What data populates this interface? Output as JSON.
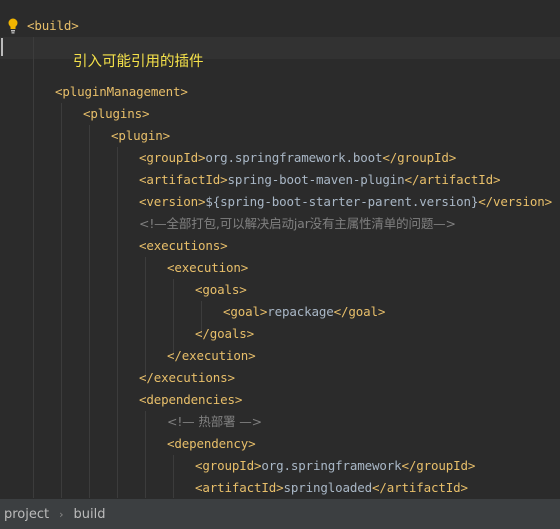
{
  "editor": {
    "annotation": "引入可能引用的插件",
    "lines": [
      {
        "tag": "build",
        "kind": "open"
      },
      {
        "tag": "pluginManagement",
        "kind": "open"
      },
      {
        "tag": "plugins",
        "kind": "open"
      },
      {
        "tag": "plugin",
        "kind": "open"
      },
      {
        "tag": "groupId",
        "value": "org.springframework.boot"
      },
      {
        "tag": "artifactId",
        "value": "spring-boot-maven-plugin"
      },
      {
        "tag": "version",
        "value": "${spring-boot-starter-parent.version}"
      },
      {
        "comment": "<!—全部打包,可以解决启动jar没有主属性清单的问题—>"
      },
      {
        "tag": "executions",
        "kind": "open"
      },
      {
        "tag": "execution",
        "kind": "open"
      },
      {
        "tag": "goals",
        "kind": "open"
      },
      {
        "tag": "goal",
        "value": "repackage"
      },
      {
        "tag": "goals",
        "kind": "close"
      },
      {
        "tag": "execution",
        "kind": "close"
      },
      {
        "tag": "executions",
        "kind": "close"
      },
      {
        "tag": "dependencies",
        "kind": "open"
      },
      {
        "comment": "<!— 热部署 —>"
      },
      {
        "tag": "dependency",
        "kind": "open"
      },
      {
        "tag": "groupId",
        "value": "org.springframework"
      },
      {
        "tag": "artifactId",
        "value": "springloaded"
      }
    ]
  },
  "breadcrumb": {
    "items": [
      "project",
      "build"
    ]
  },
  "colors": {
    "background": "#2b2b2b",
    "tag": "#e8bf6a",
    "text": "#a9b7c6",
    "comment": "#808080",
    "annotation": "#f5e24a"
  }
}
